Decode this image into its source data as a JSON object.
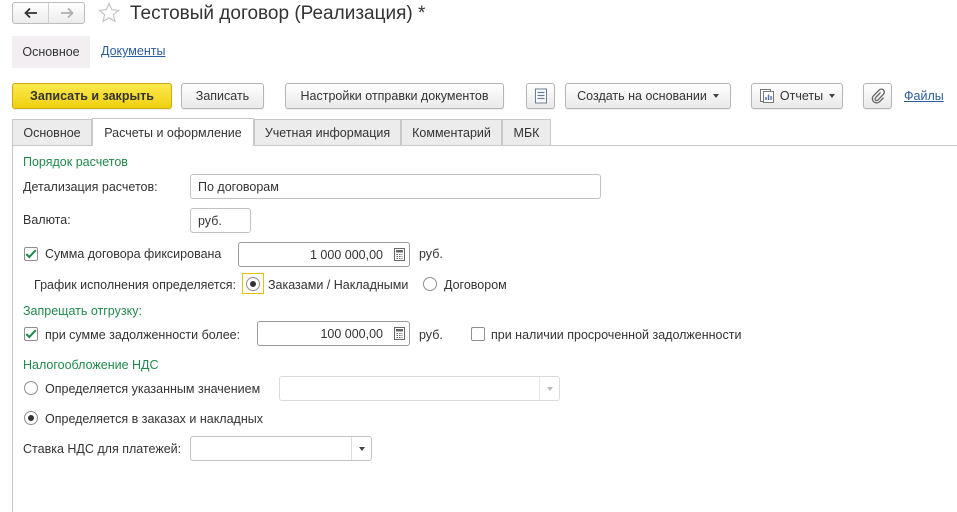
{
  "window": {
    "title": "Тестовый договор (Реализация) *"
  },
  "sections": {
    "main": "Основное",
    "documents": "Документы"
  },
  "toolbar": {
    "save_close": "Записать и закрыть",
    "save": "Записать",
    "send_settings": "Настройки отправки документов",
    "create_based": "Создать на основании",
    "reports": "Отчеты",
    "files": "Файлы"
  },
  "tabs": [
    {
      "label": "Основное"
    },
    {
      "label": "Расчеты и оформление",
      "active": true
    },
    {
      "label": "Учетная информация"
    },
    {
      "label": "Комментарий"
    },
    {
      "label": "МБК"
    }
  ],
  "form": {
    "settlement_group": "Порядок расчетов",
    "detail_label": "Детализация расчетов:",
    "detail_value": "По договорам",
    "currency_label": "Валюта:",
    "currency_value": "руб.",
    "fixed_amount_label": "Сумма договора фиксирована",
    "fixed_amount_checked": true,
    "fixed_amount_value": "1 000 000,00",
    "fixed_amount_unit": "руб.",
    "schedule_label": "График исполнения определяется:",
    "schedule_options": [
      "Заказами / Накладными",
      "Договором"
    ],
    "schedule_selected": "Заказами / Накладными",
    "forbid_group": "Запрещать отгрузку:",
    "debt_label": "при сумме задолженности более:",
    "debt_checked": true,
    "debt_value": "100 000,00",
    "debt_unit": "руб.",
    "overdue_label": "при наличии просроченной задолженности",
    "overdue_checked": false,
    "vat_group": "Налогообложение НДС",
    "vat_options": [
      "Определяется указанным значением",
      "Определяется в заказах и накладных"
    ],
    "vat_selected": "Определяется в заказах и накладных",
    "vat_value": "",
    "vat_rate_label": "Ставка НДС для платежей:",
    "vat_rate_value": ""
  },
  "colors": {
    "accent_yellow": "#f0d10f",
    "group_green": "#1f8a4c",
    "link_blue": "#2a5c9c"
  },
  "icons": [
    "back-arrow-icon",
    "forward-arrow-icon",
    "star-icon",
    "list-icon",
    "report-icon",
    "paperclip-icon",
    "calculator-icon",
    "checkmark-icon",
    "chevron-down-icon"
  ]
}
